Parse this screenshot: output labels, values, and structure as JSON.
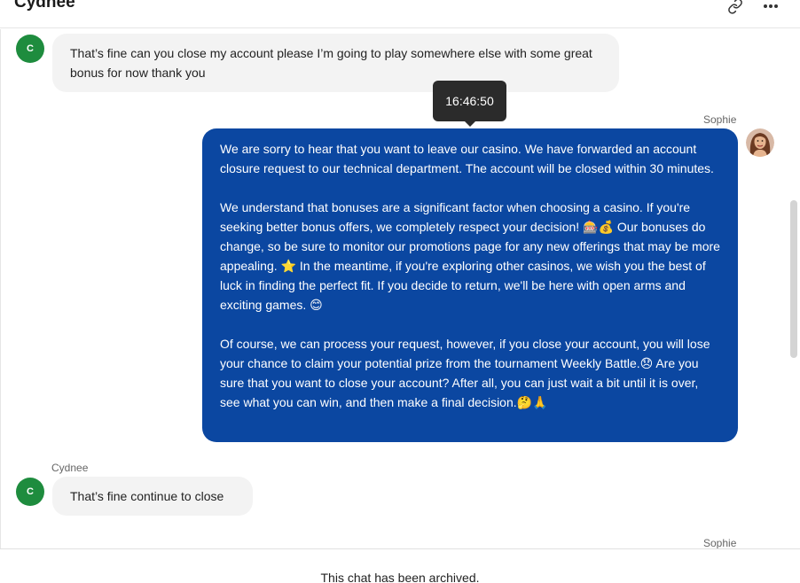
{
  "header": {
    "title": "Cydnee",
    "link_icon": "link-icon",
    "more_icon": "more-icon"
  },
  "messages": {
    "m1": {
      "avatar_initial": "C",
      "text": "That’s fine can you close my account please I’m going to play somewhere else with some great bonus for now thank you"
    },
    "tooltip_time": "16:46:50",
    "m2": {
      "sender": "Sophie",
      "p1": "We are sorry to hear that you want to leave our casino. We have forwarded an account closure request to our technical department. The account will be closed within 30 minutes.",
      "p2": "We understand that bonuses are a significant factor when choosing a casino. If you're seeking better bonus offers, we completely respect your decision! 🎰💰 Our bonuses do change, so be sure to monitor our promotions page for any new offerings that may be more appealing. ⭐ In the meantime, if you're exploring other casinos, we wish you the best of luck in finding the perfect fit. If you decide to return, we'll be here with open arms and exciting games. 😊",
      "p3": "Of course, we can process your request, however, if you close your account, you will lose your chance to claim your potential prize from the tournament Weekly Battle.😞 Are you sure that you want to close your account? After all, you can just wait a bit until it is over, see what you can win, and then make a final decision.🤔🙏"
    },
    "m3": {
      "sender": "Cydnee",
      "avatar_initial": "C",
      "text": "That’s fine continue to close"
    },
    "m4": {
      "sender": "Sophie"
    }
  },
  "footer": {
    "archived_text": "This chat has been archived."
  },
  "colors": {
    "agent_bubble": "#0b47a1",
    "customer_bubble": "#f3f3f3",
    "customer_avatar": "#1e8c3e"
  }
}
